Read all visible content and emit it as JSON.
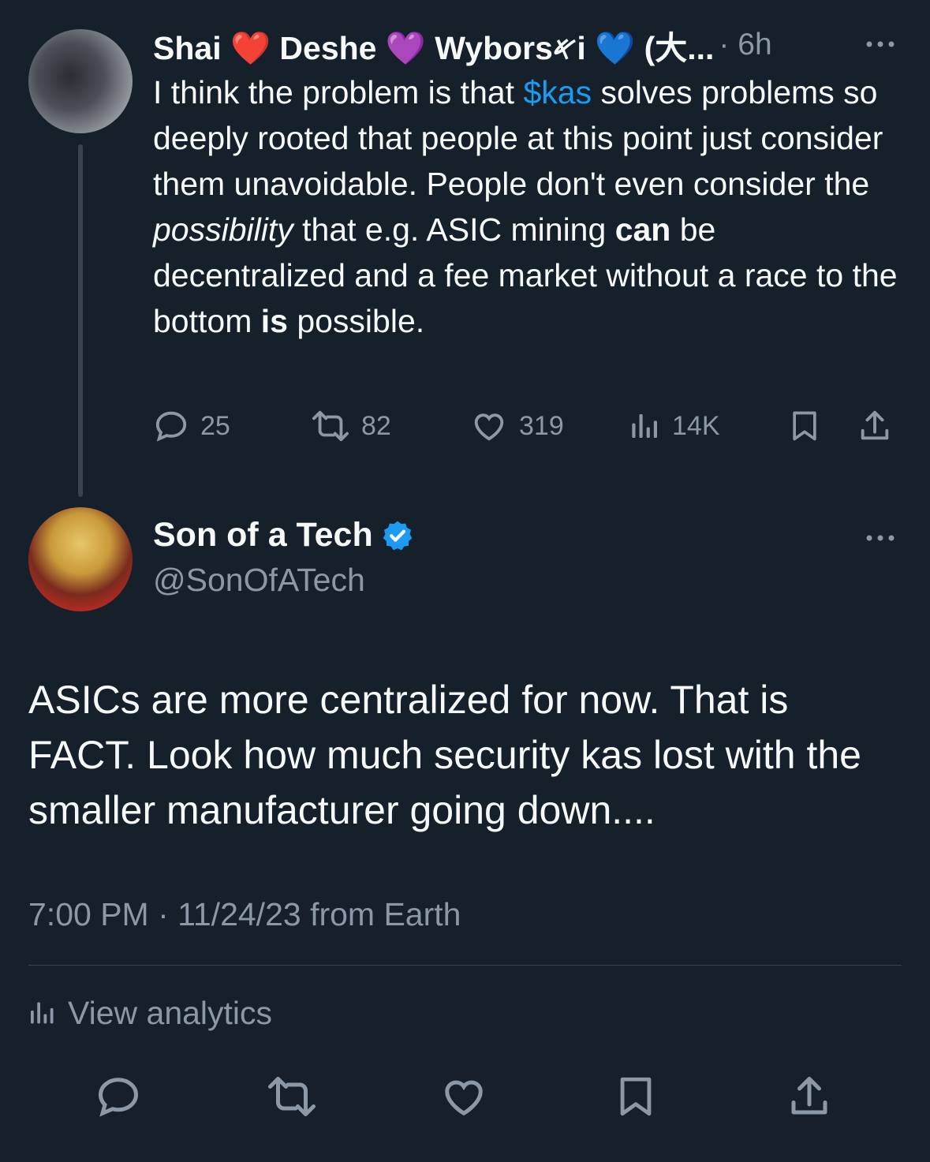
{
  "reply_tweet": {
    "author_display_name": "Shai ❤️ Deshe 💜 Wybors𐤀i 💙 (大...",
    "time_ago": "6h",
    "text_parts": [
      {
        "t": "I think the problem is that "
      },
      {
        "t": "$kas",
        "style": "link"
      },
      {
        "t": " solves problems so deeply rooted that people at this point just consider them unavoidable. People don't even consider the "
      },
      {
        "t": "possibility",
        "style": "italic"
      },
      {
        "t": " that e.g. ASIC mining "
      },
      {
        "t": "can",
        "style": "bold"
      },
      {
        "t": " be decentralized and a fee market without a race to the bottom "
      },
      {
        "t": "is",
        "style": "bold"
      },
      {
        "t": " possible."
      }
    ],
    "replies": "25",
    "reposts": "82",
    "likes": "319",
    "views": "14K"
  },
  "main_tweet": {
    "author_display_name": "Son of a Tech",
    "author_handle": "@SonOfATech",
    "verified": true,
    "text": "ASICs are more centralized for now. That is FACT. Look how much security kas lost with the smaller manufacturer going down....",
    "timestamp": "7:00 PM · 11/24/23 from Earth",
    "view_analytics_label": "View analytics"
  },
  "colors": {
    "background": "#15202b",
    "text_primary": "#f7f9f9",
    "text_secondary": "#8b98a5",
    "accent": "#1d9bf0",
    "divider": "#38444d"
  },
  "icons": {
    "reply": "reply-icon",
    "repost": "repost-icon",
    "like": "heart-icon",
    "views": "views-icon",
    "bookmark": "bookmark-icon",
    "share": "share-icon",
    "more": "more-icon",
    "verified": "verified-badge-icon"
  }
}
